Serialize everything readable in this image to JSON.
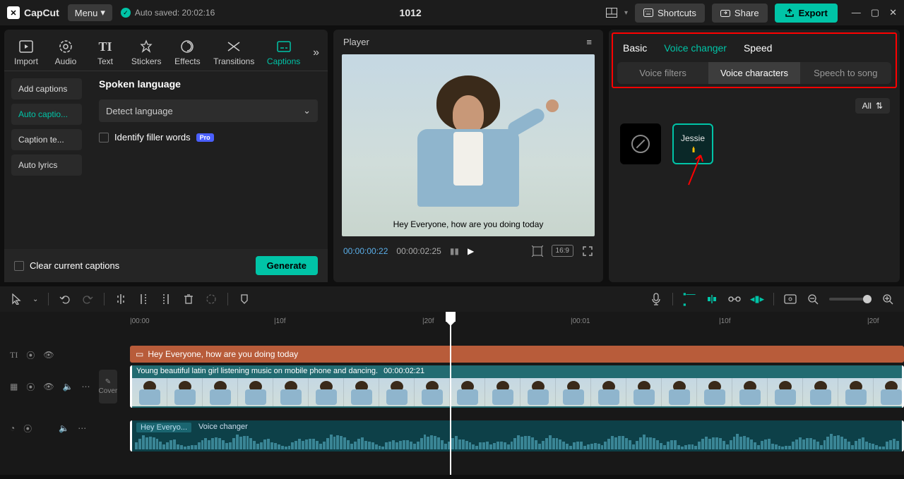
{
  "titlebar": {
    "app": "CapCut",
    "menu": "Menu",
    "autosaved": "Auto saved: 20:02:16",
    "project": "1012",
    "shortcuts": "Shortcuts",
    "share": "Share",
    "export": "Export"
  },
  "tool_tabs": {
    "import": "Import",
    "audio": "Audio",
    "text": "Text",
    "stickers": "Stickers",
    "effects": "Effects",
    "transitions": "Transitions",
    "captions": "Captions"
  },
  "captions_nav": {
    "add": "Add captions",
    "auto": "Auto captio...",
    "templates": "Caption te...",
    "lyrics": "Auto lyrics"
  },
  "captions_opts": {
    "title": "Spoken language",
    "detect": "Detect language",
    "filler": "Identify filler words",
    "pro": "Pro",
    "clear": "Clear current captions",
    "generate": "Generate"
  },
  "player": {
    "title": "Player",
    "caption": "Hey Everyone, how are you doing today",
    "time_current": "00:00:00:22",
    "time_total": "00:00:02:25",
    "ratio": "16:9"
  },
  "right": {
    "tab_basic": "Basic",
    "tab_voice": "Voice changer",
    "tab_speed": "Speed",
    "sub_filters": "Voice filters",
    "sub_characters": "Voice characters",
    "sub_speech": "Speech to song",
    "all": "All",
    "jessie": "Jessie"
  },
  "ruler": {
    "m0": "|00:00",
    "m1": "|10f",
    "m2": "|20f",
    "m3": "|00:01",
    "m4": "|10f",
    "m5": "|20f"
  },
  "timeline": {
    "cover": "Cover",
    "caption_text": "Hey Everyone, how are you doing today",
    "video_title": "Young beautiful latin girl listening music on mobile phone and dancing.",
    "video_duration": "00:00:02:21",
    "audio_label1": "Hey Everyo...",
    "audio_label2": "Voice changer"
  }
}
